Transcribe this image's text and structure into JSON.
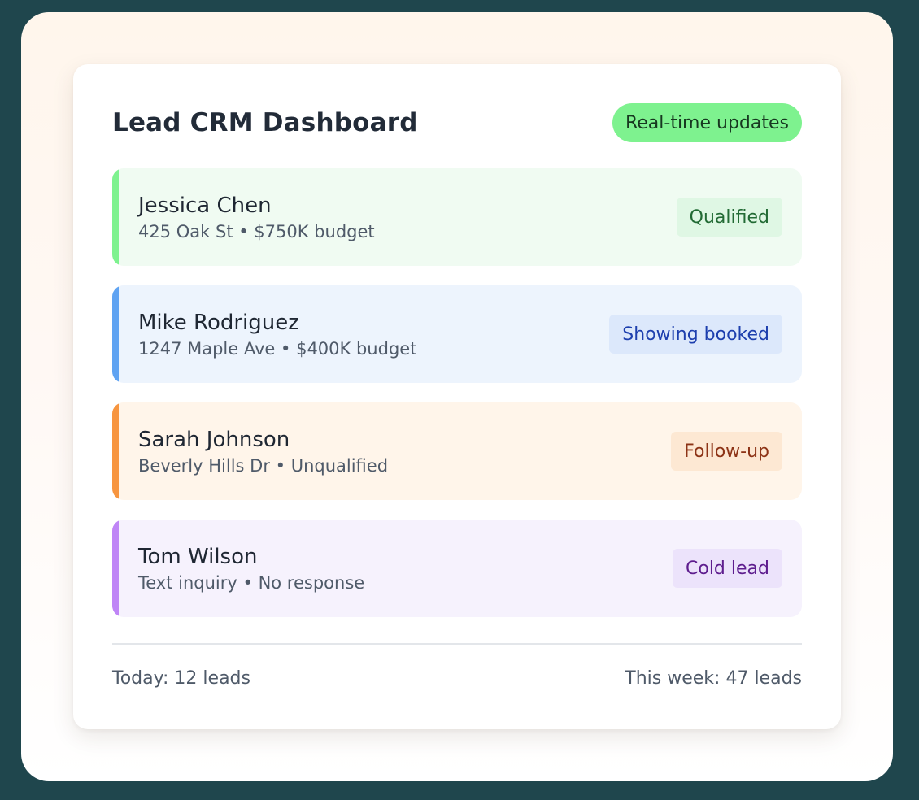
{
  "dashboard": {
    "title": "Lead CRM Dashboard",
    "live_badge": "Real-time updates"
  },
  "leads": [
    {
      "name": "Jessica Chen",
      "detail": "425 Oak St • $750K budget",
      "status": "Qualified",
      "colors": {
        "accent": "#7ef28f",
        "background": "#f0fbf2",
        "badge_bg": "#dff7e4",
        "badge_text": "#236b35"
      }
    },
    {
      "name": "Mike Rodriguez",
      "detail": "1247 Maple Ave • $400K budget",
      "status": "Showing booked",
      "colors": {
        "accent": "#5fa3f2",
        "background": "#edf4fd",
        "badge_bg": "#dce8fb",
        "badge_text": "#1d3fae"
      }
    },
    {
      "name": "Sarah Johnson",
      "detail": "Beverly Hills Dr • Unqualified",
      "status": "Follow-up",
      "colors": {
        "accent": "#f7953f",
        "background": "#fff5ea",
        "badge_bg": "#fde8d3",
        "badge_text": "#8d3316"
      }
    },
    {
      "name": "Tom Wilson",
      "detail": "Text inquiry • No response",
      "status": "Cold lead",
      "colors": {
        "accent": "#bf85f6",
        "background": "#f6f2fd",
        "badge_bg": "#ece3fb",
        "badge_text": "#5e1d8e"
      }
    }
  ],
  "footer": {
    "today": "Today: 12 leads",
    "week": "This week: 47 leads"
  }
}
